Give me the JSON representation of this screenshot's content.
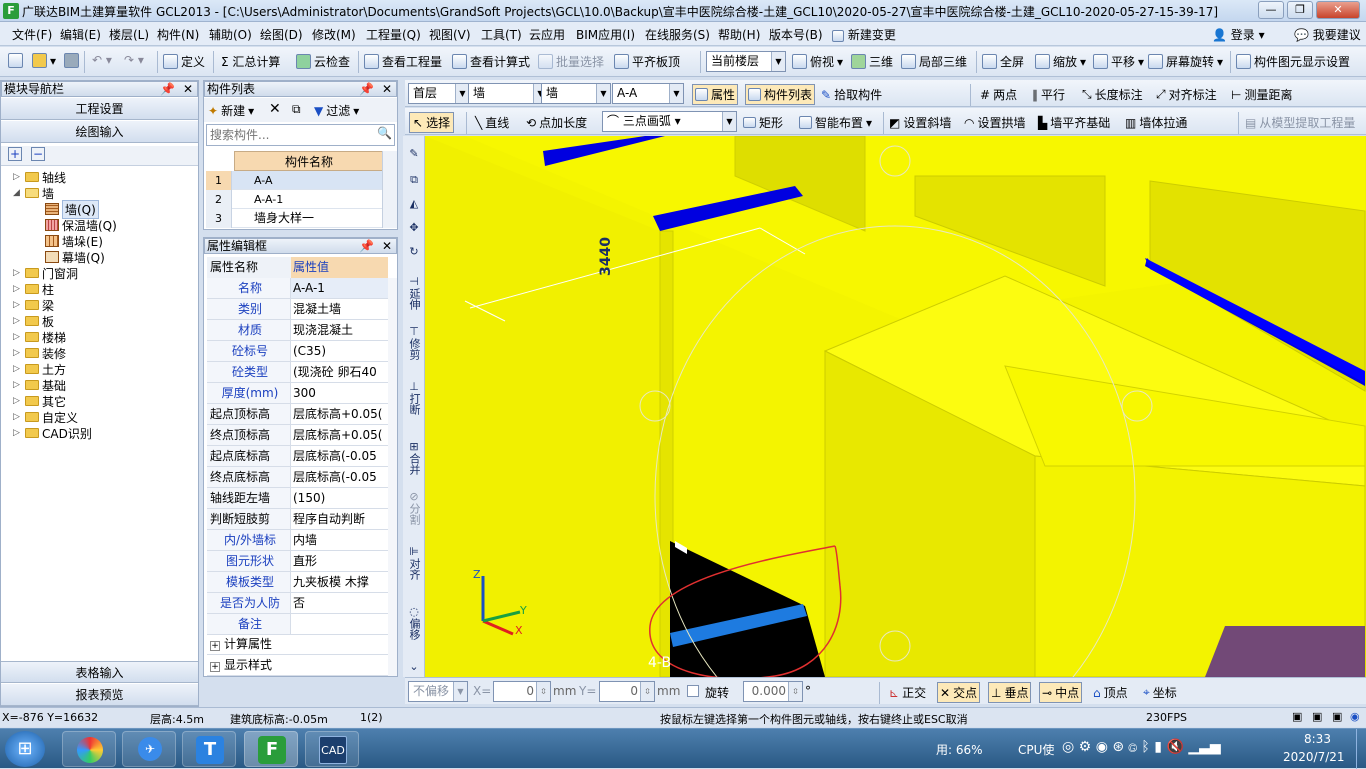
{
  "window": {
    "logo": "F",
    "title": "广联达BIM土建算量软件 GCL2013 - [C:\\Users\\Administrator\\Documents\\GrandSoft Projects\\GCL\\10.0\\Backup\\宣丰中医院综合楼-土建_GCL10\\2020-05-27\\宣丰中医院综合楼-土建_GCL10-2020-05-27-15-39-17]",
    "minimize": "—",
    "restore": "❐",
    "close": "✕"
  },
  "menu": [
    "文件(F)",
    "编辑(E)",
    "楼层(L)",
    "构件(N)",
    "辅助(O)",
    "绘图(D)",
    "修改(M)",
    "工程量(Q)",
    "视图(V)",
    "工具(T)",
    "云应用",
    "BIM应用(I)",
    "在线服务(S)",
    "帮助(H)",
    "版本号(B)",
    "新建变更"
  ],
  "menu_right": {
    "login": "登录",
    "suggest": "我要建议"
  },
  "toolbar": {
    "define": "定义",
    "sum": "Σ 汇总计算",
    "cloud_check": "云检查",
    "view_qty": "查看工程量",
    "view_formula": "查看计算式",
    "batch_select": "批量选择",
    "flush_slab": "平齐板顶",
    "floor_combo": "当前楼层",
    "top_view": "俯视",
    "three_d": "三维",
    "local_3d": "局部三维",
    "fullscreen": "全屏",
    "zoom": "缩放",
    "pan": "平移",
    "rotate": "屏幕旋转",
    "display_settings": "构件图元显示设置"
  },
  "nav": {
    "header": "模块导航栏",
    "project_settings": "工程设置",
    "draw_input": "绘图输入",
    "table_input": "表格输入",
    "report_preview": "报表预览",
    "tree": [
      {
        "label": "轴线",
        "level": 0,
        "expanded": false
      },
      {
        "label": "墙",
        "level": 0,
        "expanded": true
      },
      {
        "label": "墙(Q)",
        "level": 1,
        "selected": true
      },
      {
        "label": "保温墙(Q)",
        "level": 1
      },
      {
        "label": "墙垛(E)",
        "level": 1
      },
      {
        "label": "幕墙(Q)",
        "level": 1
      },
      {
        "label": "门窗洞",
        "level": 0
      },
      {
        "label": "柱",
        "level": 0
      },
      {
        "label": "梁",
        "level": 0
      },
      {
        "label": "板",
        "level": 0
      },
      {
        "label": "楼梯",
        "level": 0
      },
      {
        "label": "装修",
        "level": 0
      },
      {
        "label": "土方",
        "level": 0
      },
      {
        "label": "基础",
        "level": 0
      },
      {
        "label": "其它",
        "level": 0
      },
      {
        "label": "自定义",
        "level": 0
      },
      {
        "label": "CAD识别",
        "level": 0
      }
    ]
  },
  "component_list": {
    "header": "构件列表",
    "new": "新建",
    "filter": "过滤",
    "search_placeholder": "搜索构件...",
    "col_name": "构件名称",
    "rows": [
      {
        "num": "1",
        "name": "A-A",
        "selected": true
      },
      {
        "num": "2",
        "name": "A-A-1"
      },
      {
        "num": "3",
        "name": "墙身大样一"
      }
    ]
  },
  "properties": {
    "header": "属性编辑框",
    "col_name": "属性名称",
    "col_value": "属性值",
    "rows": [
      {
        "name": "名称",
        "value": "A-A-1",
        "blue": true
      },
      {
        "name": "类别",
        "value": "混凝土墙",
        "blue": true
      },
      {
        "name": "材质",
        "value": "现浇混凝土",
        "blue": true
      },
      {
        "name": "砼标号",
        "value": "(C35)",
        "blue": true
      },
      {
        "name": "砼类型",
        "value": "(现浇砼 卵石40",
        "blue": true
      },
      {
        "name": "厚度(mm)",
        "value": "300",
        "blue": true
      },
      {
        "name": "起点顶标高",
        "value": "层底标高+0.05(",
        "blue": false
      },
      {
        "name": "终点顶标高",
        "value": "层底标高+0.05(",
        "blue": false
      },
      {
        "name": "起点底标高",
        "value": "层底标高(-0.05",
        "blue": false
      },
      {
        "name": "终点底标高",
        "value": "层底标高(-0.05",
        "blue": false
      },
      {
        "name": "轴线距左墙",
        "value": "(150)",
        "blue": false
      },
      {
        "name": "判断短肢剪",
        "value": "程序自动判断",
        "blue": false
      },
      {
        "name": "内/外墙标",
        "value": "内墙",
        "blue": true
      },
      {
        "name": "图元形状",
        "value": "直形",
        "blue": true
      },
      {
        "name": "模板类型",
        "value": "九夹板模 木撑",
        "blue": true
      },
      {
        "name": "是否为人防",
        "value": "否",
        "blue": true
      },
      {
        "name": "备注",
        "value": "",
        "blue": true
      }
    ],
    "groups": [
      "计算属性",
      "显示样式"
    ]
  },
  "draw_toolbar": {
    "floor": "首层",
    "category": "墙",
    "type": "墙",
    "component": "A-A",
    "properties_btn": "属性",
    "complist_btn": "构件列表",
    "pick_btn": "拾取构件",
    "two_points": "两点",
    "parallel": "平行",
    "length_dim": "长度标注",
    "align_dim": "对齐标注",
    "measure": "测量距离",
    "select": "选择",
    "line": "直线",
    "point_extend": "点加长度",
    "arc": "三点画弧",
    "rect": "矩形",
    "smart_layout": "智能布置",
    "slope": "设置斜墙",
    "arch": "设置拱墙",
    "flush_found": "墙平齐基础",
    "stretch": "墙体拉通",
    "extract_qty": "从模型提取工程量"
  },
  "side_tools": [
    "延伸",
    "修剪",
    "打断",
    "合并",
    "分割",
    "对齐",
    "偏移"
  ],
  "scene": {
    "dimension_label": "3440",
    "axis_label": "4-B",
    "axis_z": "Z",
    "axis_x": "X",
    "axis_y": "Y"
  },
  "bottom_bar": {
    "offset_mode": "不偏移",
    "x_label": "X=",
    "x_value": "0",
    "y_label": "Y=",
    "y_value": "0",
    "unit": "mm",
    "rotate_label": "旋转",
    "rotate_value": "0.000",
    "degree": "°",
    "snap": [
      "正交",
      "交点",
      "垂点",
      "中点",
      "顶点",
      "坐标"
    ]
  },
  "status": {
    "coords": "X=-876 Y=16632",
    "floor_height": "层高:4.5m",
    "base_elev": "建筑底标高:-0.05m",
    "count": "1(2)",
    "hint": "按鼠标左键选择第一个构件图元或轴线，按右键终止或ESC取消",
    "fps": "230FPS"
  },
  "taskbar": {
    "start": "⊞",
    "mem": "用: 66%",
    "cpu": "CPU使",
    "time": "8:33",
    "date": "2020/7/21"
  }
}
